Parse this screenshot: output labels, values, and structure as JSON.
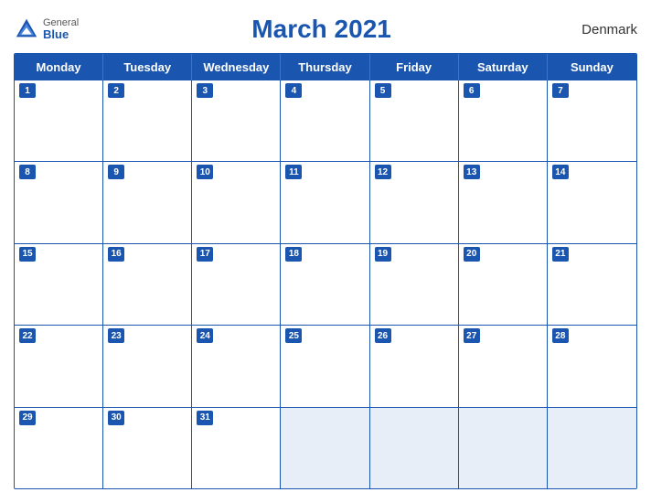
{
  "header": {
    "title": "March 2021",
    "country": "Denmark",
    "logo": {
      "general": "General",
      "blue": "Blue"
    }
  },
  "days_of_week": [
    "Monday",
    "Tuesday",
    "Wednesday",
    "Thursday",
    "Friday",
    "Saturday",
    "Sunday"
  ],
  "weeks": [
    [
      {
        "day": 1,
        "empty": false
      },
      {
        "day": 2,
        "empty": false
      },
      {
        "day": 3,
        "empty": false
      },
      {
        "day": 4,
        "empty": false
      },
      {
        "day": 5,
        "empty": false
      },
      {
        "day": 6,
        "empty": false
      },
      {
        "day": 7,
        "empty": false
      }
    ],
    [
      {
        "day": 8,
        "empty": false
      },
      {
        "day": 9,
        "empty": false
      },
      {
        "day": 10,
        "empty": false
      },
      {
        "day": 11,
        "empty": false
      },
      {
        "day": 12,
        "empty": false
      },
      {
        "day": 13,
        "empty": false
      },
      {
        "day": 14,
        "empty": false
      }
    ],
    [
      {
        "day": 15,
        "empty": false
      },
      {
        "day": 16,
        "empty": false
      },
      {
        "day": 17,
        "empty": false
      },
      {
        "day": 18,
        "empty": false
      },
      {
        "day": 19,
        "empty": false
      },
      {
        "day": 20,
        "empty": false
      },
      {
        "day": 21,
        "empty": false
      }
    ],
    [
      {
        "day": 22,
        "empty": false
      },
      {
        "day": 23,
        "empty": false
      },
      {
        "day": 24,
        "empty": false
      },
      {
        "day": 25,
        "empty": false
      },
      {
        "day": 26,
        "empty": false
      },
      {
        "day": 27,
        "empty": false
      },
      {
        "day": 28,
        "empty": false
      }
    ],
    [
      {
        "day": 29,
        "empty": false
      },
      {
        "day": 30,
        "empty": false
      },
      {
        "day": 31,
        "empty": false
      },
      {
        "day": null,
        "empty": true
      },
      {
        "day": null,
        "empty": true
      },
      {
        "day": null,
        "empty": true
      },
      {
        "day": null,
        "empty": true
      }
    ]
  ]
}
